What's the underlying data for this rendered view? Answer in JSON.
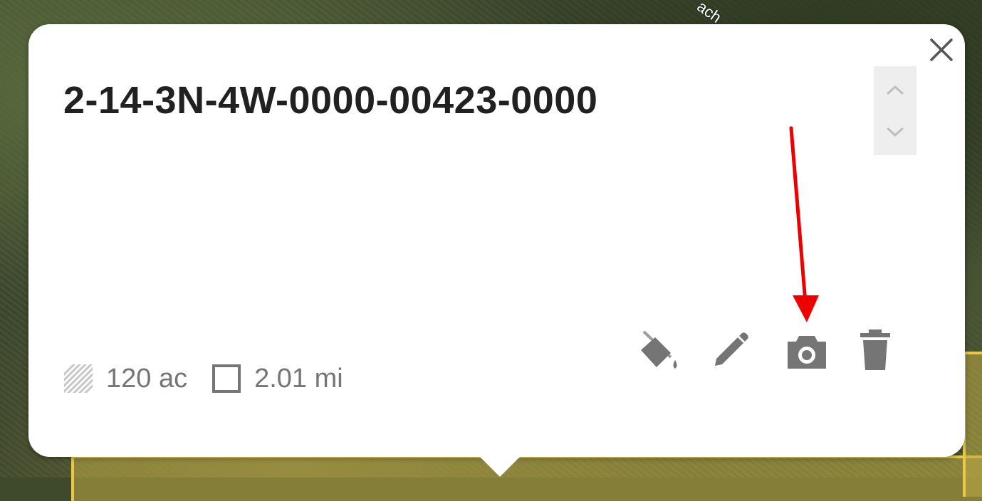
{
  "map": {
    "road_label": "ach"
  },
  "popup": {
    "title": "2-14-3N-4W-0000-00423-0000",
    "close_icon": "close-icon",
    "nav": {
      "prev_icon": "chevron-up-icon",
      "next_icon": "chevron-down-icon"
    },
    "stats": {
      "area": "120 ac",
      "perimeter": "2.01 mi",
      "area_icon": "hatched-area-icon",
      "perimeter_icon": "square-outline-icon"
    },
    "actions": [
      {
        "icon": "paint-bucket-icon"
      },
      {
        "icon": "pencil-icon"
      },
      {
        "icon": "camera-icon"
      },
      {
        "icon": "trash-icon"
      }
    ]
  },
  "annotation": {
    "color": "#ee0000"
  },
  "colors": {
    "icon_gray": "#757575",
    "title": "#212121",
    "parcel_outline": "#e9c948"
  }
}
